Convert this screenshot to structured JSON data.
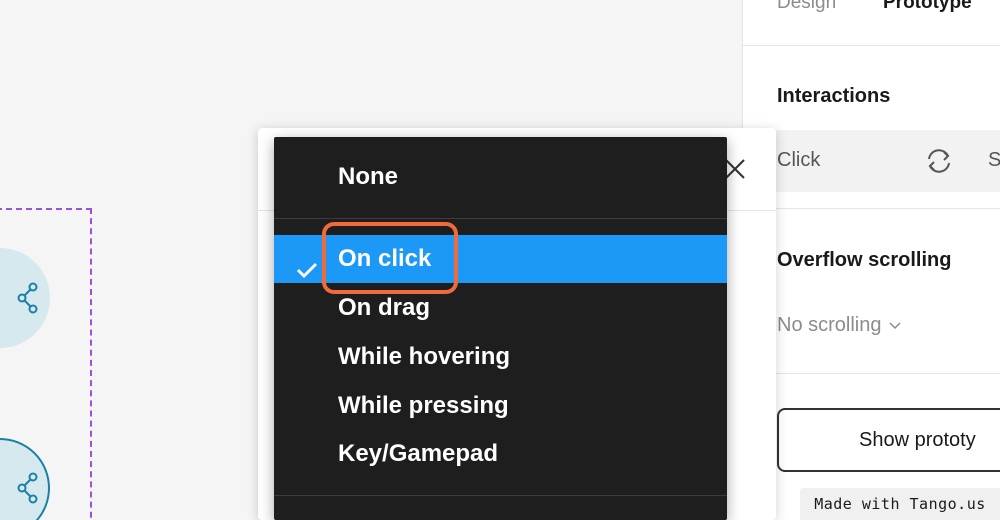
{
  "panel": {
    "tabs": [
      {
        "label": "Design",
        "active": false
      },
      {
        "label": "Prototype",
        "active": true
      }
    ],
    "interactions_title": "Interactions",
    "interaction": {
      "trigger": "Click",
      "icon": "cycle-icon",
      "action_partial": "S"
    },
    "overflow": {
      "title": "Overflow scrolling",
      "value": "No scrolling"
    },
    "show_prototype_label": "Show prototy"
  },
  "dropdown": {
    "items": [
      {
        "label": "None",
        "selected": false
      },
      {
        "label": "On click",
        "selected": true
      },
      {
        "label": "On drag",
        "selected": false
      },
      {
        "label": "While hovering",
        "selected": false
      },
      {
        "label": "While pressing",
        "selected": false
      },
      {
        "label": "Key/Gamepad",
        "selected": false
      }
    ],
    "selected_color": "#1c98f7"
  },
  "colors": {
    "accent": "#1c98f7",
    "highlight_ring": "#f06a3d",
    "frame_outline": "#9b51e0",
    "node_fill": "#d6e9ef",
    "node_stroke": "#1c7fa6"
  },
  "watermark": "Made with Tango.us"
}
